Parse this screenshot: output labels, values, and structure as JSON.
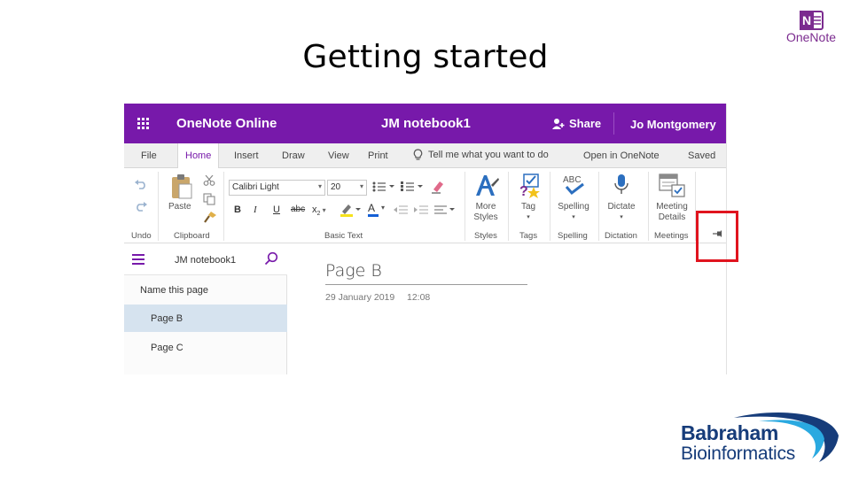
{
  "slide": {
    "title": "Getting started",
    "onenote_logo_text": "OneNote",
    "onenote_logo_letter": "N",
    "brand_lines": [
      "Babraham",
      "Bioinformatics"
    ]
  },
  "titlebar": {
    "app_name": "OneNote Online",
    "document": "JM notebook1",
    "share_label": "Share",
    "user": "Jo Montgomery",
    "color": "#7719AA"
  },
  "tabs": {
    "file": "File",
    "home": "Home",
    "insert": "Insert",
    "draw": "Draw",
    "view": "View",
    "print": "Print",
    "tell_me": "Tell me what you want to do",
    "open_in": "Open in OneNote",
    "status": "Saved"
  },
  "ribbon": {
    "undo_group": "Undo",
    "clipboard_group": "Clipboard",
    "paste_label": "Paste",
    "basic_text_group": "Basic Text",
    "font_name": "Calibri Light",
    "font_size": "20",
    "bold": "B",
    "italic": "I",
    "underline": "U",
    "strikethrough": "abc",
    "subscript": "x",
    "subscript_mark": "2",
    "font_color": "A",
    "styles_group": "Styles",
    "more_styles_1": "More",
    "more_styles_2": "Styles",
    "tags_group": "Tags",
    "tag_label": "Tag",
    "spelling_group": "Spelling",
    "spelling_label": "Spelling",
    "abc_label": "ABC",
    "dictation_group": "Dictation",
    "dictate_label": "Dictate",
    "meetings_group": "Meetings",
    "meeting_details_1": "Meeting",
    "meeting_details_2": "Details"
  },
  "nav": {
    "notebook": "JM notebook1",
    "items": [
      {
        "label": "Name this page",
        "selected": false
      },
      {
        "label": "Page B",
        "selected": true
      },
      {
        "label": "Page C",
        "selected": false
      }
    ]
  },
  "page": {
    "title": "Page B",
    "date": "29 January 2019",
    "time": "12:08"
  },
  "colors": {
    "highlight_box": "#e0141e",
    "selected_page": "#d6e3ef",
    "brand_blue": "#163c7a"
  }
}
